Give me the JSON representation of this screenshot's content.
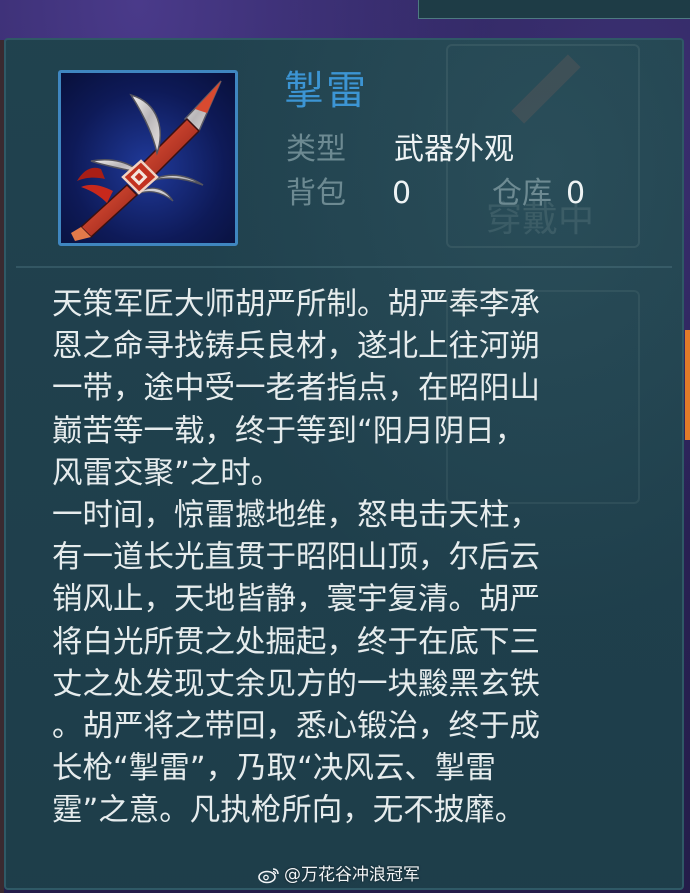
{
  "item": {
    "name": "掣雷",
    "type_label": "类型",
    "type_value": "武器外观",
    "bag_label": "背包",
    "bag_count": "0",
    "warehouse_label": "仓库",
    "warehouse_count": "0",
    "icon": "spear-weapon-icon"
  },
  "description": {
    "lines": [
      "天策军匠大师胡严所制。胡严奉李承",
      "恩之命寻找铸兵良材，遂北上往河朔",
      "一带，途中受一老者指点，在昭阳山",
      "巅苦等一载，终于等到“阳月阴日，",
      "风雷交聚”之时。",
      "一时间，惊雷撼地维，怒电击天柱，",
      "有一道长光直贯于昭阳山顶，尔后云",
      "销风止，天地皆静，寰宇复清。胡严",
      "将白光所贯之处掘起，终于在底下三",
      "丈之处发现丈余见方的一块黢黑玄铁",
      "。胡严将之带回，悉心锻治，终于成",
      "长枪“掣雷”，乃取“决风云、掣雷",
      "霆”之意。凡执枪所向，无不披靡。"
    ]
  },
  "background": {
    "ghost_text": "穿戴中"
  },
  "watermark": {
    "text": "@万花谷冲浪冠军"
  },
  "colors": {
    "panel_bg": "#1f3f4c",
    "name_blue": "#3c95d4",
    "label_gray": "#6d8a92",
    "text_white": "#e6eced",
    "icon_border": "#3f86c0"
  }
}
